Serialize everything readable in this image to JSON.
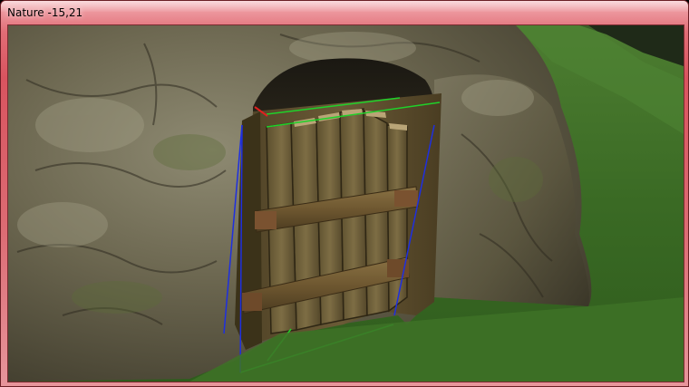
{
  "window": {
    "title": "Nature -15,21",
    "accent_color": "#d9545f",
    "frame_color": "#e27a82"
  },
  "viewport": {
    "scene_description_icon": "3d-scene-icon",
    "objects": [
      {
        "name": "cave-rock",
        "color": "#6f6a52"
      },
      {
        "name": "wooden-door",
        "color": "#5e4f2e"
      },
      {
        "name": "grass-ground",
        "color": "#3d6e28"
      }
    ],
    "selection_colors": {
      "edge_green": "#1fd12a",
      "edge_blue": "#1e2fe0",
      "edge_red": "#e02020"
    }
  }
}
